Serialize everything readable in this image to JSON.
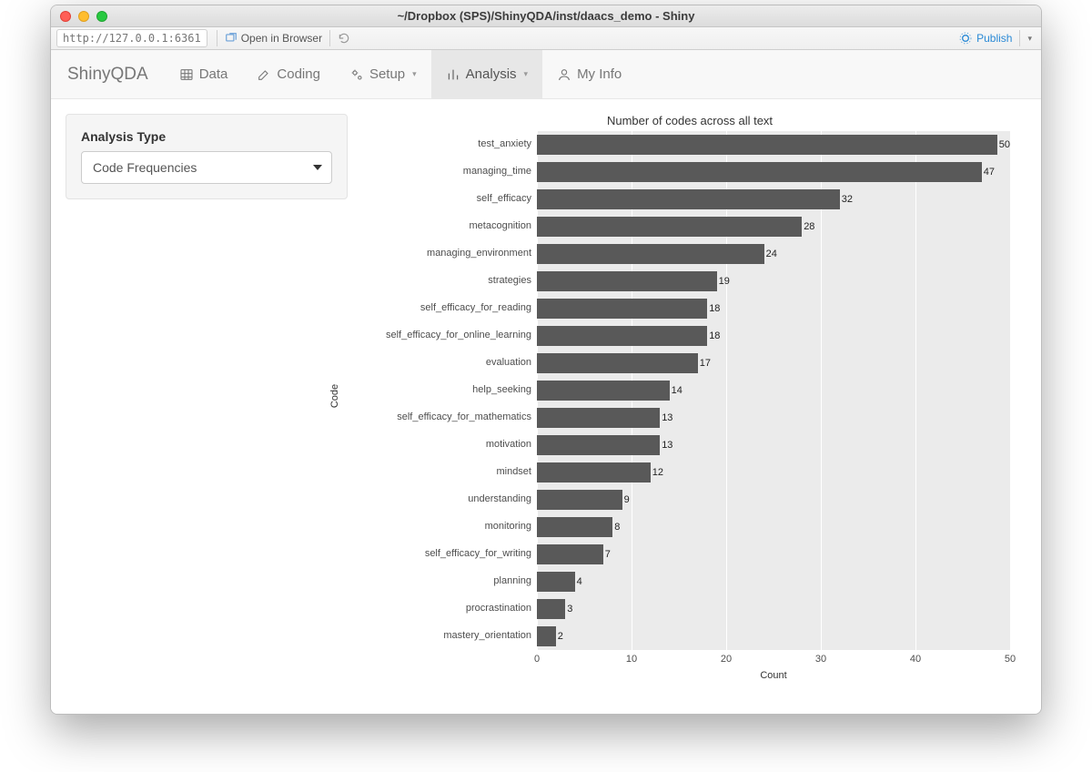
{
  "window": {
    "title": "~/Dropbox (SPS)/ShinyQDA/inst/daacs_demo - Shiny"
  },
  "toolbar": {
    "url": "http://127.0.0.1:6361",
    "open_browser": "Open in Browser",
    "publish": "Publish"
  },
  "navbar": {
    "brand": "ShinyQDA",
    "items": [
      {
        "label": "Data"
      },
      {
        "label": "Coding"
      },
      {
        "label": "Setup",
        "caret": true
      },
      {
        "label": "Analysis",
        "caret": true,
        "active": true
      },
      {
        "label": "My Info"
      }
    ]
  },
  "sidebar": {
    "label": "Analysis Type",
    "select_value": "Code Frequencies"
  },
  "chart_data": {
    "type": "bar",
    "orientation": "horizontal",
    "title": "Number of codes across all text",
    "ylabel": "Code",
    "xlabel": "Count",
    "xlim": [
      0,
      50
    ],
    "xticks": [
      0,
      10,
      20,
      30,
      40,
      50
    ],
    "categories": [
      "test_anxiety",
      "managing_time",
      "self_efficacy",
      "metacognition",
      "managing_environment",
      "strategies",
      "self_efficacy_for_reading",
      "self_efficacy_for_online_learning",
      "evaluation",
      "help_seeking",
      "self_efficacy_for_mathematics",
      "motivation",
      "mindset",
      "understanding",
      "monitoring",
      "self_efficacy_for_writing",
      "planning",
      "procrastination",
      "mastery_orientation"
    ],
    "values": [
      50,
      47,
      32,
      28,
      24,
      19,
      18,
      18,
      17,
      14,
      13,
      13,
      12,
      9,
      8,
      7,
      4,
      3,
      2
    ]
  }
}
